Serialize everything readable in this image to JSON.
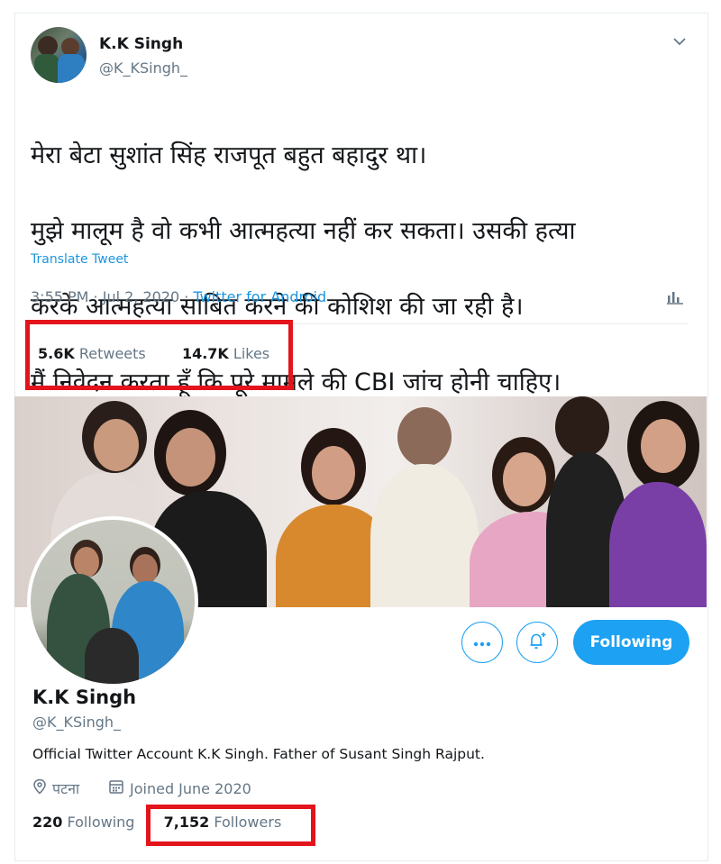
{
  "tweet": {
    "author_name": "K.K Singh",
    "author_handle": "@K_KSingh_",
    "text_lines": [
      "मेरा बेटा सुशांत सिंह राजपूत बहुत बहादुर था।",
      "मुझे मालूम है वो कभी आत्महत्या नहीं कर सकता। उसकी हत्या",
      "करके आत्महत्या साबित करने की कोशिश की जा रही है।",
      "मैं निवेदन करता हूँ कि पूरे मामले की CBI जांच होनी चाहिए।"
    ],
    "translate_label": "Translate Tweet",
    "timestamp": "3:55 PM · Jul 2, 2020 ·",
    "source": "Twitter for Android",
    "retweets_count": "5.6K",
    "retweets_label": "Retweets",
    "likes_count": "14.7K",
    "likes_label": "Likes"
  },
  "profile": {
    "name": "K.K Singh",
    "handle": "@K_KSingh_",
    "bio": "Official Twitter Account K.K Singh. Father of Susant Singh Rajput.",
    "location": "पटना",
    "joined": "Joined June 2020",
    "following_count": "220",
    "following_label": "Following",
    "followers_count": "7,152",
    "followers_label": "Followers",
    "follow_button_label": "Following",
    "more_icon": "more-icon",
    "notify_icon": "bell-plus-icon"
  },
  "colors": {
    "accent": "#1da1f2",
    "highlight_box": "#e3141b",
    "muted_text": "#657786"
  }
}
